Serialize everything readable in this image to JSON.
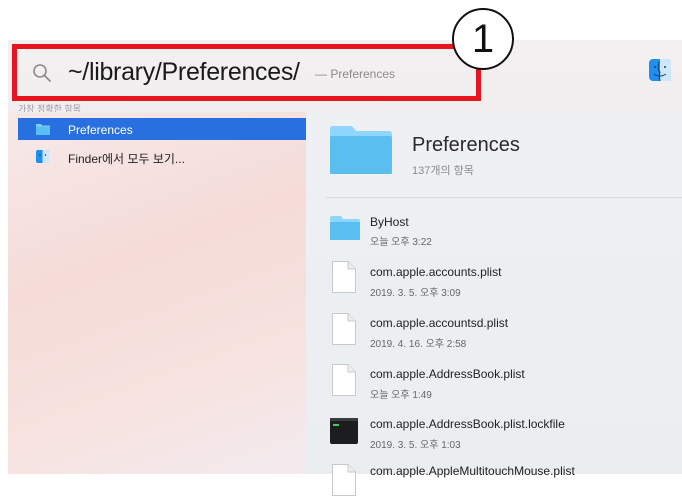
{
  "annotation": {
    "number": "1"
  },
  "search": {
    "query": "~/library/Preferences/",
    "hint": "— Preferences"
  },
  "sidebar": {
    "section_header": "가장 정확한 항목",
    "items": [
      {
        "label": "Preferences",
        "icon": "folder-icon",
        "selected": true
      },
      {
        "label": "Finder에서 모두 보기...",
        "icon": "finder-icon",
        "selected": false
      }
    ]
  },
  "preview": {
    "title": "Preferences",
    "subtitle": "137개의 항목",
    "files": [
      {
        "name": "ByHost",
        "date": "오늘 오후 3:22",
        "icon": "folder-icon"
      },
      {
        "name": "com.apple.accounts.plist",
        "date": "2019. 3. 5. 오후 3:09",
        "icon": "document-icon"
      },
      {
        "name": "com.apple.accountsd.plist",
        "date": "2019. 4. 16. 오후 2:58",
        "icon": "document-icon"
      },
      {
        "name": "com.apple.AddressBook.plist",
        "date": "오늘 오후 1:49",
        "icon": "document-icon"
      },
      {
        "name": "com.apple.AddressBook.plist.lockfile",
        "date": "2019. 3. 5. 오후 1:03",
        "icon": "terminal-icon"
      },
      {
        "name": "com.apple.AppleMultitouchMouse.plist",
        "date": "",
        "icon": "document-icon"
      }
    ]
  },
  "colors": {
    "selection": "#2870e0",
    "highlight_box": "#e8141e",
    "folder_blue": "#5bbef0"
  }
}
